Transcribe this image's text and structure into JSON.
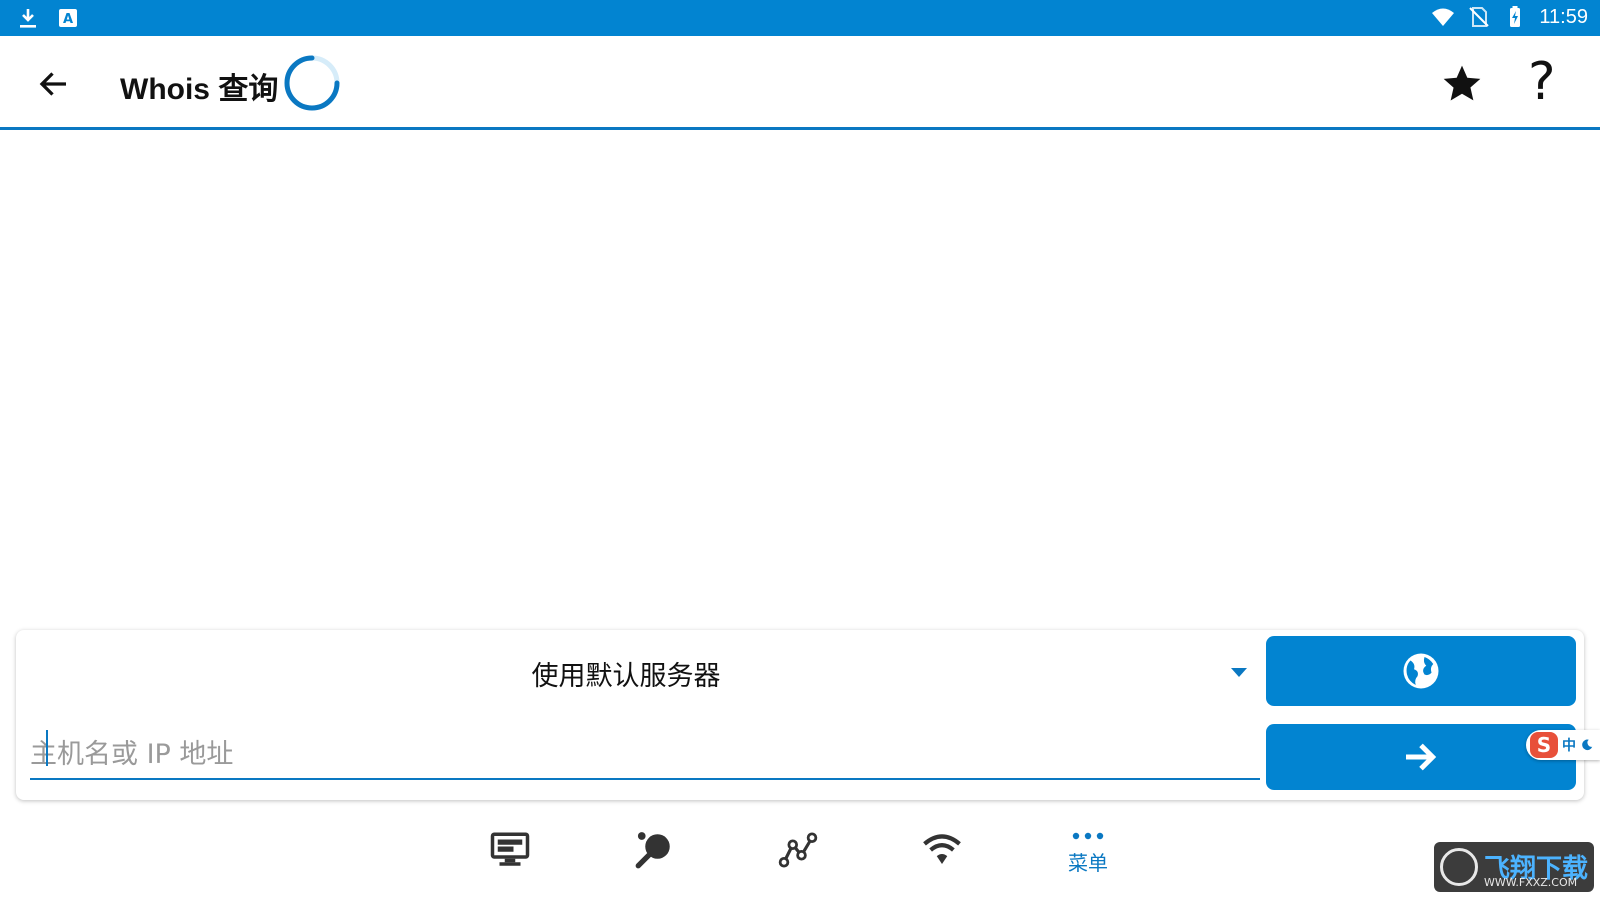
{
  "status_bar": {
    "time": "11:59",
    "left_icons": [
      "download-icon",
      "keyboard-a-icon"
    ],
    "right_icons": [
      "wifi-icon",
      "no-sim-icon",
      "battery-charging-icon"
    ]
  },
  "toolbar": {
    "title": "Whois 查询",
    "back_icon": "arrow-left-icon",
    "favorite_icon": "star-icon",
    "help_label": "?"
  },
  "query_card": {
    "server_select_value": "使用默认服务器",
    "host_placeholder": "主机名或 IP 地址",
    "host_value": "",
    "globe_button_icon": "globe-icon",
    "go_button_icon": "arrow-right-icon"
  },
  "ime_badge": {
    "logo": "S",
    "mode": "中"
  },
  "bottom_nav": {
    "items": [
      {
        "icon": "monitor-icon"
      },
      {
        "icon": "ping-pong-icon"
      },
      {
        "icon": "route-graph-icon"
      },
      {
        "icon": "wifi-icon"
      },
      {
        "icon": "more-dots-icon",
        "label": "菜单"
      }
    ]
  },
  "watermark": {
    "title": "飞翔下载",
    "url": "WWW.FXXZ.COM"
  },
  "colors": {
    "primary": "#0284d1",
    "accent": "#0a78c2"
  }
}
